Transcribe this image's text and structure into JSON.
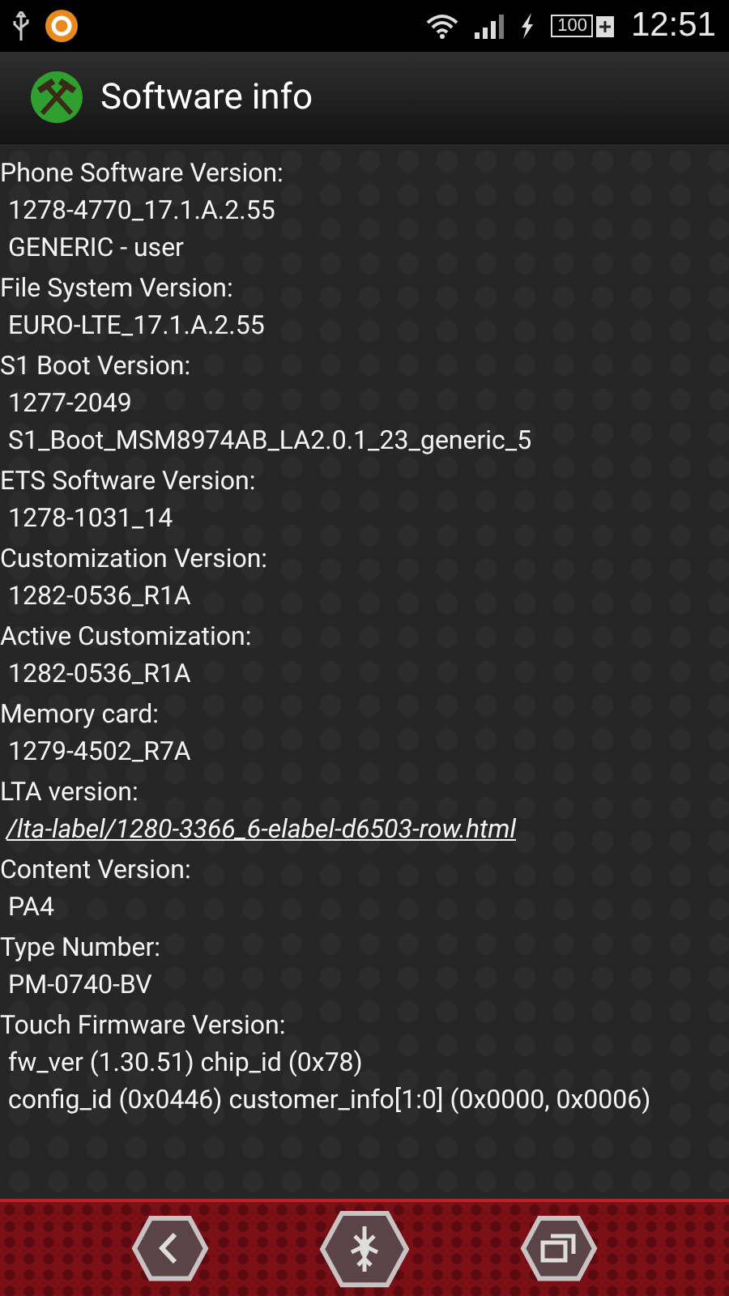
{
  "status_bar": {
    "battery": "100",
    "time": "12:51"
  },
  "header": {
    "title": "Software info"
  },
  "sections": [
    {
      "label": "Phone Software Version:",
      "values": [
        {
          "kind": "text",
          "text": "1278-4770_17.1.A.2.55"
        },
        {
          "kind": "text",
          "text": "GENERIC - user"
        }
      ]
    },
    {
      "label": "File System Version:",
      "values": [
        {
          "kind": "text",
          "text": "EURO-LTE_17.1.A.2.55"
        }
      ]
    },
    {
      "label": "S1 Boot Version:",
      "values": [
        {
          "kind": "text",
          "text": "1277-2049"
        },
        {
          "kind": "text",
          "text": "S1_Boot_MSM8974AB_LA2.0.1_23_generic_5"
        }
      ]
    },
    {
      "label": "ETS Software Version:",
      "values": [
        {
          "kind": "text",
          "text": "1278-1031_14"
        }
      ]
    },
    {
      "label": "Customization Version:",
      "values": [
        {
          "kind": "text",
          "text": "1282-0536_R1A"
        }
      ]
    },
    {
      "label": "Active Customization:",
      "values": [
        {
          "kind": "text",
          "text": "1282-0536_R1A"
        }
      ]
    },
    {
      "label": "Memory card:",
      "values": [
        {
          "kind": "text",
          "text": "1279-4502_R7A"
        }
      ]
    },
    {
      "label": "LTA version:",
      "values": [
        {
          "kind": "link",
          "text": "/lta-label/1280-3366_6-elabel-d6503-row.html"
        }
      ]
    },
    {
      "label": "Content Version:",
      "values": [
        {
          "kind": "text",
          "text": "PA4"
        }
      ]
    },
    {
      "label": "Type Number:",
      "values": [
        {
          "kind": "text",
          "text": "PM-0740-BV"
        }
      ]
    },
    {
      "label": "Touch Firmware Version:",
      "values": [
        {
          "kind": "text",
          "text": "fw_ver (1.30.51) chip_id (0x78)"
        },
        {
          "kind": "text",
          "text": "config_id (0x0446) customer_info[1:0] (0x0000, 0x0006)"
        }
      ]
    }
  ]
}
